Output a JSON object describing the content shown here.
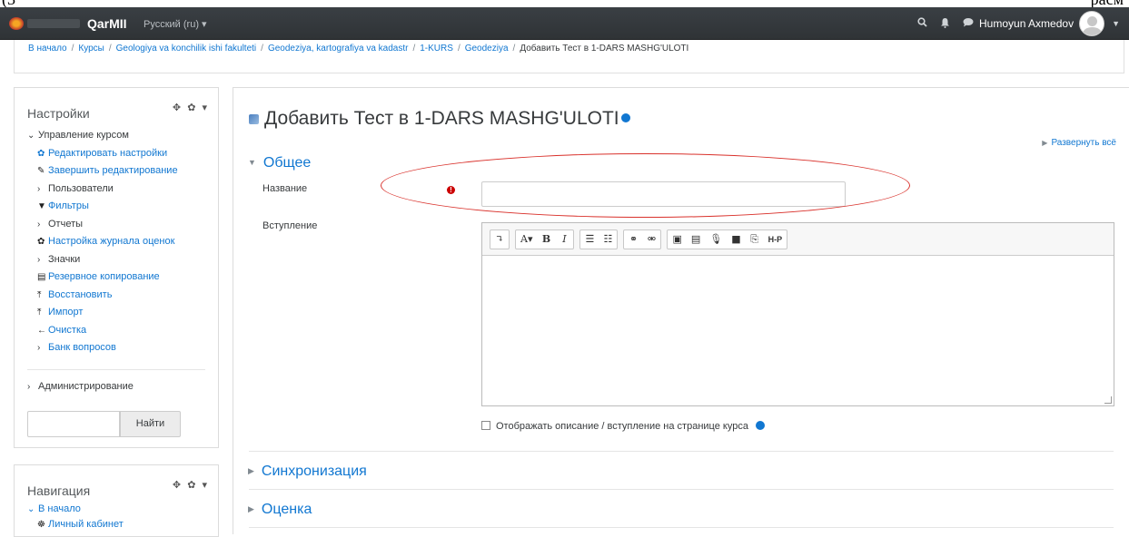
{
  "top_artifacts": {
    "left": "(3",
    "right": "paсм"
  },
  "navbar": {
    "brand": "QarMII",
    "language": "Русский (ru) ▾",
    "user_name": "Humoyun Axmedov",
    "search_icon": "search-icon",
    "bell_icon": "bell-icon",
    "chat_icon": "chat-icon"
  },
  "breadcrumb": [
    "В начало",
    "Курсы",
    "Geologiya va konchilik ishi fakulteti",
    "Geodeziya, kartografiya va kadastr",
    "1-KURS",
    "Geodeziya",
    "Добавить Тест в 1-DARS MASHG'ULOTI"
  ],
  "settings_block": {
    "title": "Настройки",
    "tools": "✥ ✿ ▾",
    "course_admin": "Управление курсом",
    "items": [
      {
        "icon": "gear-icon",
        "label": "Редактировать настройки",
        "link": true
      },
      {
        "icon": "pencil-icon",
        "label": "Завершить редактирование",
        "link": true
      },
      {
        "icon": "chevron-right-icon",
        "label": "Пользователи",
        "link": false
      },
      {
        "icon": "filter-icon",
        "label": "Фильтры",
        "link": true
      },
      {
        "icon": "chevron-right-icon",
        "label": "Отчеты",
        "link": false
      },
      {
        "icon": "gear-icon",
        "label": "Настройка журнала оценок",
        "link": true
      },
      {
        "icon": "chevron-right-icon",
        "label": "Значки",
        "link": false
      },
      {
        "icon": "file-icon",
        "label": "Резервное копирование",
        "link": true
      },
      {
        "icon": "upload-icon",
        "label": "Восстановить",
        "link": true
      },
      {
        "icon": "upload-icon",
        "label": "Импорт",
        "link": true
      },
      {
        "icon": "arrow-left-icon",
        "label": "Очистка",
        "link": true
      },
      {
        "icon": "chevron-right-icon",
        "label": "Банк вопросов",
        "link": true
      }
    ],
    "administration": "Администрирование",
    "search_button": "Найти"
  },
  "navigation_block": {
    "title": "Навигация",
    "tools": "✥ ✿ ▾",
    "home": "В начало",
    "dashboard": "Личный кабинет"
  },
  "main": {
    "title": "Добавить Тест в 1-DARS MASHG'ULOTI",
    "expand_all": "Развернуть всё",
    "section_general": "Общее",
    "name_label": "Название",
    "name_value": "",
    "intro_label": "Вступление",
    "toolbar_groups": [
      [
        "↴"
      ],
      [
        "A▾",
        "B",
        "I"
      ],
      [
        "☰",
        "☷"
      ],
      [
        "⚭",
        "⚮"
      ],
      [
        "▣",
        "▤",
        "🎙",
        "■",
        "⎘",
        "H-P"
      ]
    ],
    "show_description": "Отображать описание / вступление на странице курса",
    "section_sync": "Синхронизация",
    "section_grade": "Оценка"
  },
  "colors": {
    "link": "#1177d1",
    "navbar": "#2f3336",
    "required": "#cc0000",
    "annotation": "#d9312b"
  }
}
